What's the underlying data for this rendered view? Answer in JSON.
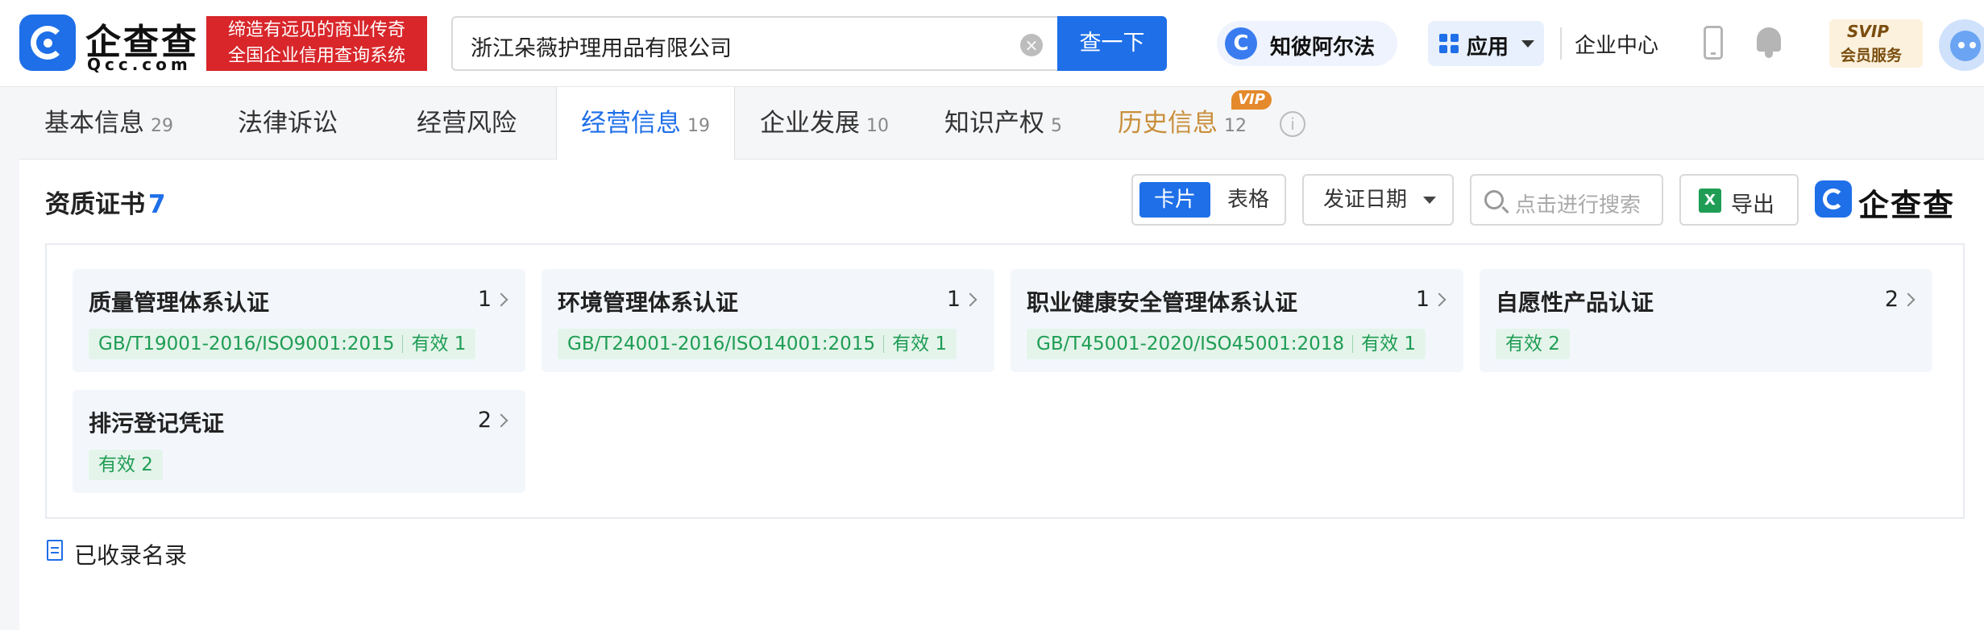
{
  "brand": {
    "logo_cn": "企查查",
    "logo_en": "Qcc.com",
    "slogan_line1": "缔造有远见的商业传奇",
    "slogan_line2": "全国企业信用查询系统"
  },
  "search": {
    "value": "浙江朵薇护理用品有限公司",
    "button_label": "查一下"
  },
  "header": {
    "zhibi_label": "知彼阿尔法",
    "apps_label": "应用",
    "enterprise_center": "企业中心",
    "svip_title": "SVIP",
    "svip_sub": "会员服务"
  },
  "tabs": [
    {
      "label": "基本信息",
      "count": "29",
      "active": false
    },
    {
      "label": "法律诉讼",
      "count": "",
      "active": false
    },
    {
      "label": "经营风险",
      "count": "",
      "active": false
    },
    {
      "label": "经营信息",
      "count": "19",
      "active": true
    },
    {
      "label": "企业发展",
      "count": "10",
      "active": false
    },
    {
      "label": "知识产权",
      "count": "5",
      "active": false
    },
    {
      "label": "历史信息",
      "count": "12",
      "active": false,
      "badge": "VIP"
    }
  ],
  "section": {
    "title": "资质证书",
    "count": "7"
  },
  "toolbar": {
    "view_card": "卡片",
    "view_table": "表格",
    "date_filter": "发证日期",
    "search_placeholder": "点击进行搜索",
    "export_label": "导出",
    "brand_mark": "企查查"
  },
  "cards": [
    {
      "name": "质量管理体系认证",
      "count": "1",
      "standard": "GB/T19001-2016/ISO9001:2015",
      "status": "有效 1"
    },
    {
      "name": "环境管理体系认证",
      "count": "1",
      "standard": "GB/T24001-2016/ISO14001:2015",
      "status": "有效 1"
    },
    {
      "name": "职业健康安全管理体系认证",
      "count": "1",
      "standard": "GB/T45001-2020/ISO45001:2018",
      "status": "有效 1"
    },
    {
      "name": "自愿性产品认证",
      "count": "2",
      "standard": "",
      "status": "有效 2"
    },
    {
      "name": "排污登记凭证",
      "count": "2",
      "standard": "",
      "status": "有效 2"
    }
  ],
  "footer": {
    "included_label": "已收录名录"
  },
  "colors": {
    "primary": "#1e6fe8",
    "brand_red": "#d8262a",
    "tag_green": "#1f9d55",
    "vip_gold": "#c98f3c"
  }
}
